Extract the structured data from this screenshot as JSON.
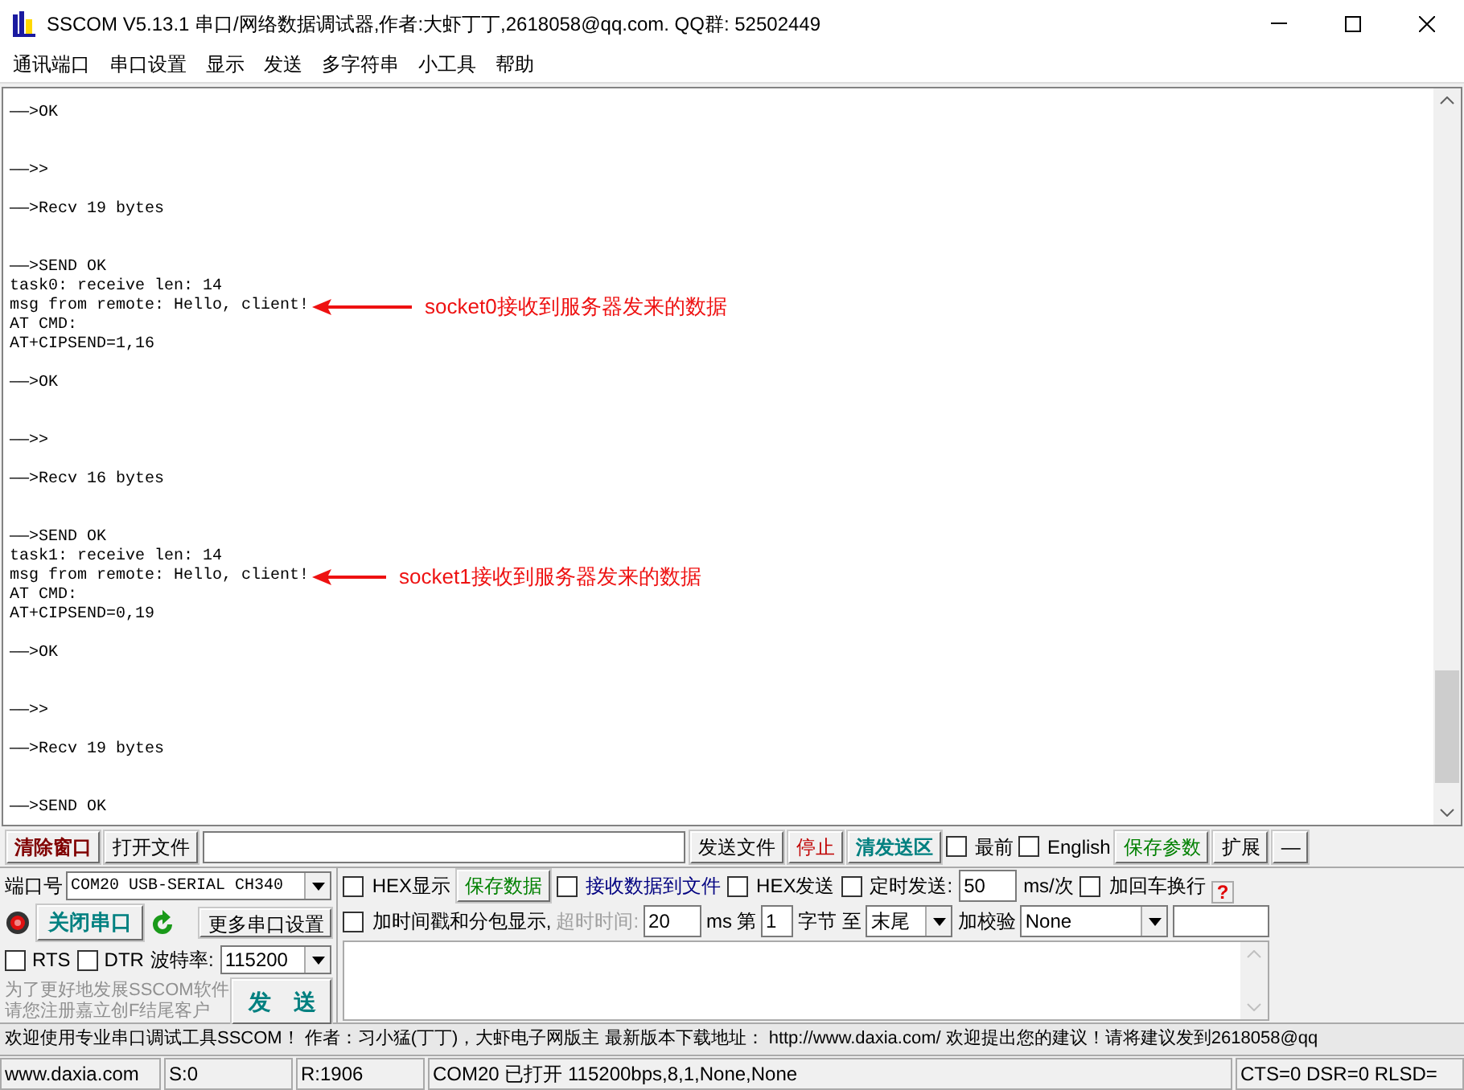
{
  "window": {
    "title": "SSCOM V5.13.1 串口/网络数据调试器,作者:大虾丁丁,2618058@qq.com. QQ群: 52502449"
  },
  "menu": [
    "通讯端口",
    "串口设置",
    "显示",
    "发送",
    "多字符串",
    "小工具",
    "帮助"
  ],
  "terminal": {
    "blocks": [
      {
        "text": "——>OK\n\n\n——>>\n\n——>Recv 19 bytes\n\n\n——>SEND OK\ntask0: receive len: 14",
        "last": "msg from remote: Hello, client!",
        "annotation": "socket0接收到服务器发来的数据"
      },
      {
        "text": "AT CMD:\nAT+CIPSEND=1,16\n\n——>OK\n\n\n——>>\n\n——>Recv 16 bytes\n\n\n——>SEND OK\ntask1: receive len: 14",
        "last": "msg from remote: Hello, client!",
        "annotation": "socket1接收到服务器发来的数据"
      },
      {
        "text": "AT CMD:\nAT+CIPSEND=0,19\n\n——>OK\n\n\n——>>\n\n——>Recv 19 bytes\n\n\n——>SEND OK"
      }
    ]
  },
  "toolbar": [
    {
      "kind": "bold_button",
      "label": "清除窗口",
      "color": "#800000"
    },
    {
      "kind": "button",
      "label": "打开文件"
    },
    {
      "kind": "input"
    },
    {
      "kind": "button",
      "label": "发送文件"
    },
    {
      "kind": "button",
      "label": "停止",
      "color": "#c00000"
    },
    {
      "kind": "bold_button",
      "label": "清发送区",
      "color": "#008080"
    },
    {
      "kind": "checkbox",
      "label": "最前",
      "checked": false
    },
    {
      "kind": "checkbox",
      "label": "English",
      "checked": false
    },
    {
      "kind": "button",
      "label": "保存参数",
      "color": "#008000"
    },
    {
      "kind": "button",
      "label": "扩展"
    },
    {
      "kind": "button",
      "label": "—"
    }
  ],
  "port": {
    "label": "端口号",
    "value": "COM20 USB-SERIAL CH340"
  },
  "port_led_on": true,
  "open_button": "关闭串口",
  "more_settings": "更多串口设置",
  "rts": {
    "label": "RTS",
    "checked": false
  },
  "dtr": {
    "label": "DTR",
    "checked": false
  },
  "baud": {
    "label": "波特率:",
    "value": "115200"
  },
  "promo": [
    "为了更好地发展SSCOM软件",
    "请您注册嘉立创F结尾客户"
  ],
  "send_button": "发　送",
  "options_row_1": [
    {
      "kind": "checkbox",
      "label": "HEX显示",
      "checked": false
    },
    {
      "kind": "button",
      "label": "保存数据",
      "color": "#008000"
    },
    {
      "kind": "checkbox",
      "label": "接收数据到文件",
      "checked": false,
      "color": "#000080"
    },
    {
      "kind": "checkbox",
      "label": "HEX发送",
      "checked": false
    },
    {
      "kind": "checkbox",
      "label": "定时发送:",
      "checked": false
    },
    {
      "kind": "input",
      "value": "50"
    },
    {
      "kind": "text",
      "label": "ms/次"
    },
    {
      "kind": "checkbox",
      "label": "加回车换行",
      "checked": false
    },
    {
      "kind": "help",
      "label": "?"
    }
  ],
  "options_row_2": [
    {
      "kind": "checkbox",
      "label": "加时间戳和分包显示,",
      "checked": false
    },
    {
      "kind": "text",
      "label": "超时时间:",
      "color": "#a0a0a0"
    },
    {
      "kind": "input",
      "value": "20"
    },
    {
      "kind": "text",
      "label": "ms"
    },
    {
      "kind": "text",
      "label": "第"
    },
    {
      "kind": "input",
      "value": "1"
    },
    {
      "kind": "text",
      "label": "字节 至"
    },
    {
      "kind": "select",
      "value": "末尾"
    },
    {
      "kind": "text",
      "label": "加校验"
    },
    {
      "kind": "select",
      "value": "None"
    },
    {
      "kind": "input"
    }
  ],
  "marquee": "欢迎使用专业串口调试工具SSCOM！ 作者：习小猛(丁丁)，大虾电子网版主 最新版本下载地址： http://www.daxia.com/ 欢迎提出您的建议！请将建议发到2618058@qq",
  "status_bar": [
    "www.daxia.com",
    "S:0",
    "R:1906",
    "COM20 已打开  115200bps,8,1,None,None",
    "CTS=0 DSR=0 RLSD="
  ]
}
